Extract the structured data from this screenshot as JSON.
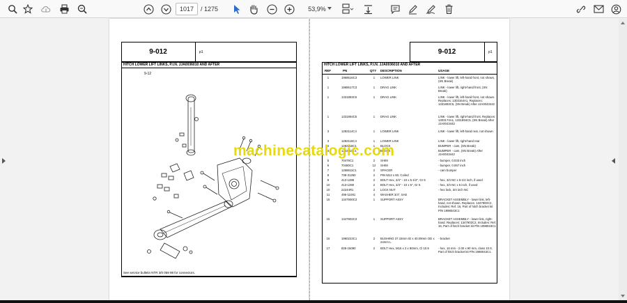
{
  "toolbar": {
    "page_current": "1017",
    "page_total": "/ 1275",
    "zoom": "53,9%"
  },
  "left_page": {
    "header_code": "9-012",
    "header_p": "p1",
    "title": "HITCH LOWER LIFT LINKS, P.I.N. JJA0036010 AND AFTER",
    "figure_label": "9-12",
    "footer": "See service bulletin NTR 3/0 059 98 for connectors."
  },
  "right_page": {
    "header_code": "9-012",
    "header_p": "p1",
    "title": "HITCH LOWER LIFT LINKS, P.I.N. JJA0036010 AND AFTER",
    "columns": [
      "REF",
      "PN",
      "QTY",
      "DESCRIPTION",
      "USAGE"
    ],
    "rows": [
      {
        "ref": "1",
        "pn": "1968616C3",
        "qty": "1",
        "desc": "LOWER LINK",
        "use": "LINK - lower lift, left-hand front, not shown, (SN Break)"
      },
      {
        "ref": "1",
        "pn": "1968617C3",
        "qty": "1",
        "desc": "DRAG LINK",
        "use": "LINK - lower lift, right-hand front, (SN Break)"
      },
      {
        "ref": "1",
        "pn": "1331893C5",
        "qty": "1",
        "desc": "DRAG LINK",
        "use": "LINK - lower lift, left-hand front, not shown. Replaces: 1303164A1, Replaces: 1331893C5, (SN Break) After JJA0043442"
      },
      {
        "ref": "1",
        "pn": "1331894C5",
        "qty": "1",
        "desc": "DRAG LINK",
        "use": "LINK - lower lift, right-hand front. Replaces: 1303174A1, 1331894C5, (SN Break) After JJA0043442"
      },
      {
        "ref": "3",
        "pn": "1282114C4",
        "qty": "1",
        "desc": "LOWER LINK",
        "use": "LINK - lower lift, left-hand rear, not shown"
      },
      {
        "ref": "3",
        "pn": "1282115C4",
        "qty": "1",
        "desc": "LOWER LINK",
        "use": "LINK - lower lift, right-hand rear"
      },
      {
        "ref": "4",
        "pn": "1282118C1",
        "qty": "1",
        "desc": "BLOCK",
        "use": "BUMPER - cam, (SN Break)"
      },
      {
        "ref": "4",
        "pn": "1282119C1",
        "qty": "1",
        "desc": "BLOCK",
        "use": "BUMPER - cam, (SN Break) After JJA0043442"
      },
      {
        "ref": "5",
        "pn": "70479C1",
        "qty": "2",
        "desc": "SHIM",
        "use": "- bumper, 0.033 inch"
      },
      {
        "ref": "6",
        "pn": "70480C1",
        "qty": "12",
        "desc": "SHIM",
        "use": "- bumper, 0.067 inch"
      },
      {
        "ref": "7",
        "pn": "1268811C1",
        "qty": "2",
        "desc": "SPACER",
        "use": "- cam bumper"
      },
      {
        "ref": "8",
        "pn": "738-31260",
        "qty": "2",
        "desc": "PIN M12 x 60, Coiled",
        "use": ""
      },
      {
        "ref": "9",
        "pn": "413-1288",
        "qty": "2",
        "desc": "BOLT Hex, 3/4\" - 10 x 5-1/2\", Gr 5",
        "use": "- hex, 3/4 NC x 5-1/2 inch, if used"
      },
      {
        "ref": "10",
        "pn": "413-1280",
        "qty": "2",
        "desc": "BOLT Hex, 3/4\" - 10 x 5\", Gr 5",
        "use": "- hex, 3/4 NC x 5 inch, if used"
      },
      {
        "ref": "10",
        "pn": "22244R1",
        "qty": "2",
        "desc": "LOCK NUT",
        "use": "- hex lock, 3/4 inch NC"
      },
      {
        "ref": "11",
        "pn": "496-11081",
        "qty": "4",
        "desc": "WASHER 3/4\", SAE",
        "use": ""
      },
      {
        "ref": "15",
        "pn": "1347900C3",
        "qty": "1",
        "desc": "SUPPORT ASSY",
        "use": "BRACKET ASSEMBLY - lower link, left-hand, not shown. Replaces: 1347900C2, Includes: Ref. 16, Part of hitch bracket kit P/N 1998043C1"
      },
      {
        "ref": "15",
        "pn": "1347902C3",
        "qty": "1",
        "desc": "SUPPORT ASSY",
        "use": "BRACKET ASSEMBLY - lower link, right-hand. Replaces: 1347902C2, Includes: Ref. 16, Part of hitch bracket kit P/N 1998043C1"
      },
      {
        "ref": "16",
        "pn": "1960223C1",
        "qty": "2",
        "desc": "BUSHING 37.15mm ID x 40.09mm OD x 24mm L",
        "use": "- bracket"
      },
      {
        "ref": "17",
        "pn": "828-16090",
        "qty": "2",
        "desc": "BOLT Hex, M16 x 2 x 90mm, Cl 10.9",
        "use": "- hex, 16 mm - 2.00 x 90 mm, class 10.9, Part of hitch bracket kit P/N 1998043C1."
      }
    ]
  },
  "watermark": "machinecatalogic.com"
}
